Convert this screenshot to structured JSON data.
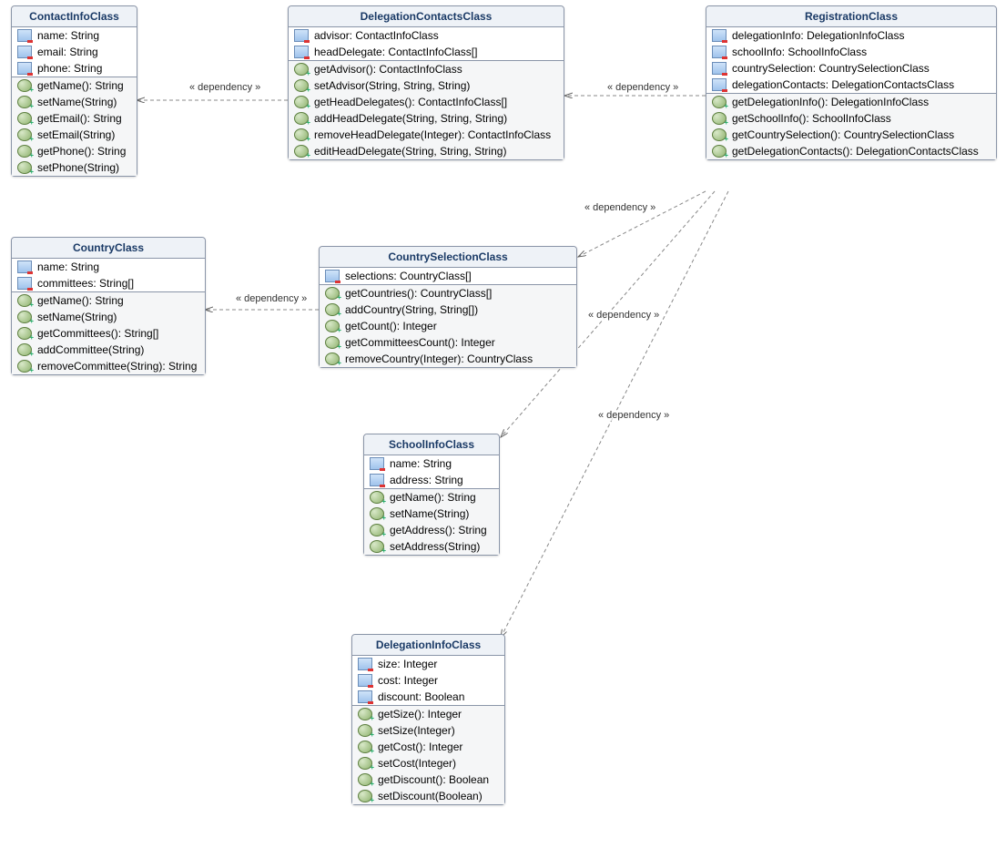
{
  "labels": {
    "dependency": "« dependency »"
  },
  "classes": {
    "contactInfo": {
      "title": "ContactInfoClass",
      "attrs": [
        "name: String",
        "email: String",
        "phone: String"
      ],
      "meths": [
        "getName(): String",
        "setName(String)",
        "getEmail(): String",
        "setEmail(String)",
        "getPhone(): String",
        "setPhone(String)"
      ]
    },
    "delegationContacts": {
      "title": "DelegationContactsClass",
      "attrs": [
        "advisor: ContactInfoClass",
        "headDelegate: ContactInfoClass[]"
      ],
      "meths": [
        "getAdvisor(): ContactInfoClass",
        "setAdvisor(String, String, String)",
        "getHeadDelegates(): ContactInfoClass[]",
        "addHeadDelegate(String, String, String)",
        "removeHeadDelegate(Integer): ContactInfoClass",
        "editHeadDelegate(String, String, String)"
      ]
    },
    "registration": {
      "title": "RegistrationClass",
      "attrs": [
        "delegationInfo: DelegationInfoClass",
        "schoolInfo: SchoolInfoClass",
        "countrySelection: CountrySelectionClass",
        "delegationContacts: DelegationContactsClass"
      ],
      "meths": [
        "getDelegationInfo(): DelegationInfoClass",
        "getSchoolInfo(): SchoolInfoClass",
        "getCountrySelection(): CountrySelectionClass",
        "getDelegationContacts(): DelegationContactsClass"
      ]
    },
    "country": {
      "title": "CountryClass",
      "attrs": [
        "name: String",
        "committees: String[]"
      ],
      "meths": [
        "getName(): String",
        "setName(String)",
        "getCommittees(): String[]",
        "addCommittee(String)",
        "removeCommittee(String): String"
      ]
    },
    "countrySelection": {
      "title": "CountrySelectionClass",
      "attrs": [
        "selections: CountryClass[]"
      ],
      "meths": [
        "getCountries(): CountryClass[]",
        "addCountry(String, String[])",
        "getCount(): Integer",
        "getCommitteesCount(): Integer",
        "removeCountry(Integer): CountryClass"
      ]
    },
    "schoolInfo": {
      "title": "SchoolInfoClass",
      "attrs": [
        "name: String",
        "address: String"
      ],
      "meths": [
        "getName(): String",
        "setName(String)",
        "getAddress(): String",
        "setAddress(String)"
      ]
    },
    "delegationInfo": {
      "title": "DelegationInfoClass",
      "attrs": [
        "size: Integer",
        "cost: Integer",
        "discount: Boolean"
      ],
      "meths": [
        "getSize(): Integer",
        "setSize(Integer)",
        "getCost(): Integer",
        "setCost(Integer)",
        "getDiscount(): Boolean",
        "setDiscount(Boolean)"
      ]
    }
  }
}
